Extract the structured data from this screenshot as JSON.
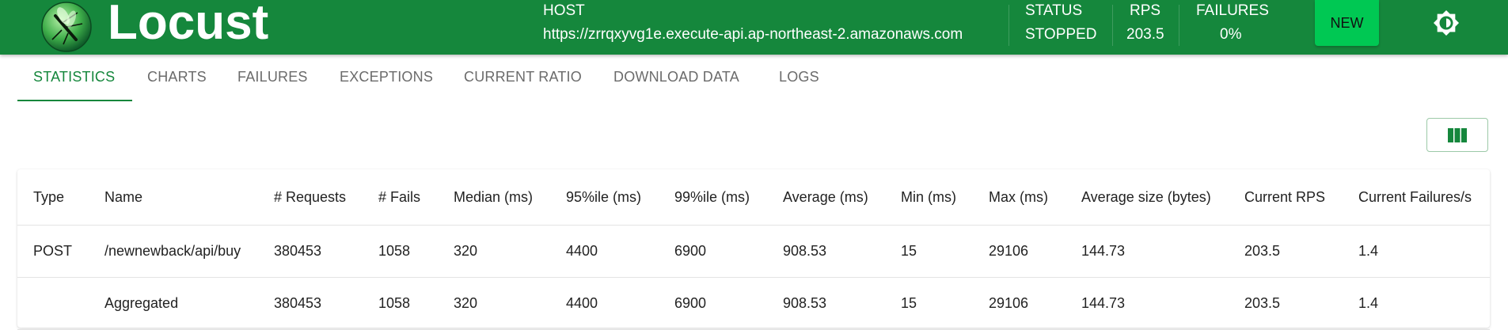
{
  "header": {
    "app_name": "Locust",
    "host_label": "HOST",
    "host_value": "https://zrrqxyvg1e.execute-api.ap-northeast-2.amazonaws.com",
    "status_label": "STATUS",
    "status_value": "STOPPED",
    "rps_label": "RPS",
    "rps_value": "203.5",
    "failures_label": "FAILURES",
    "failures_value": "0%",
    "new_button": "NEW",
    "theme_icon": "brightness-icon"
  },
  "tabs": [
    "STATISTICS",
    "CHARTS",
    "FAILURES",
    "EXCEPTIONS",
    "CURRENT RATIO",
    "DOWNLOAD DATA",
    "LOGS"
  ],
  "active_tab": "STATISTICS",
  "toolbar": {
    "columns_icon": "view-columns-icon"
  },
  "table": {
    "headers": [
      "Type",
      "Name",
      "# Requests",
      "# Fails",
      "Median (ms)",
      "95%ile (ms)",
      "99%ile (ms)",
      "Average (ms)",
      "Min (ms)",
      "Max (ms)",
      "Average size (bytes)",
      "Current RPS",
      "Current Failures/s"
    ],
    "rows": [
      [
        "POST",
        "/newnewback/api/buy",
        "380453",
        "1058",
        "320",
        "4400",
        "6900",
        "908.53",
        "15",
        "29106",
        "144.73",
        "203.5",
        "1.4"
      ],
      [
        "",
        "Aggregated",
        "380453",
        "1058",
        "320",
        "4400",
        "6900",
        "908.53",
        "15",
        "29106",
        "144.73",
        "203.5",
        "1.4"
      ]
    ]
  },
  "colors": {
    "primary": "#15873c",
    "new_button": "#00c853"
  }
}
